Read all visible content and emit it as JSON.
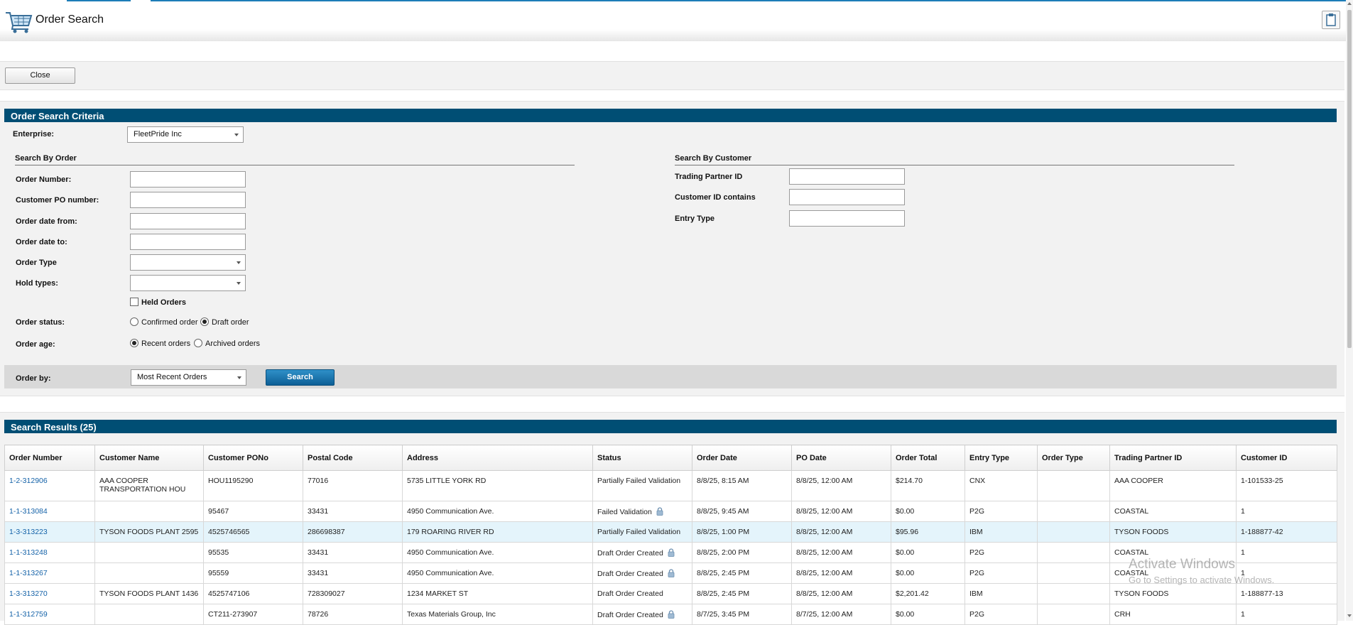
{
  "header": {
    "title": "Order Search",
    "cart_icon": "shopping-cart-icon",
    "clipboard_icon": "clipboard-icon"
  },
  "toolbar": {
    "close_label": "Close"
  },
  "criteria": {
    "title": "Order Search Criteria",
    "enterprise": {
      "label": "Enterprise:",
      "value": "FleetPride Inc"
    },
    "by_order": {
      "title": "Search By Order",
      "order_number": "Order Number:",
      "customer_po": "Customer PO number:",
      "date_from": "Order date from:",
      "date_to": "Order date to:",
      "order_type": "Order Type",
      "hold_types": "Hold types:",
      "held_orders": "Held Orders",
      "order_status": "Order status:",
      "status_confirmed": "Confirmed order",
      "status_draft": "Draft order",
      "order_age": "Order age:",
      "age_recent": "Recent orders",
      "age_archived": "Archived orders",
      "order_by": "Order by:",
      "order_by_value": "Most Recent Orders",
      "search_label": "Search"
    },
    "by_customer": {
      "title": "Search By Customer",
      "trading_partner": "Trading Partner ID",
      "customer_id": "Customer ID contains",
      "entry_type": "Entry Type"
    }
  },
  "results": {
    "title": "Search Results (25)",
    "columns": [
      "Order Number",
      "Customer Name",
      "Customer PONo",
      "Postal Code",
      "Address",
      "Status",
      "Order Date",
      "PO Date",
      "Order Total",
      "Entry Type",
      "Order Type",
      "Trading Partner ID",
      "Customer ID"
    ],
    "rows": [
      [
        "1-2-312906",
        "AAA COOPER TRANSPORTATION HOU",
        "HOU1195290",
        "77016",
        "5735 LITTLE YORK RD",
        "Partially Failed Validation",
        "8/8/25, 8:15 AM",
        "8/8/25, 12:00 AM",
        "$214.70",
        "CNX",
        "",
        "AAA COOPER",
        "1-101533-25"
      ],
      [
        "1-1-313084",
        "",
        "95467",
        "33431",
        "4950 Communication Ave.",
        "Failed Validation",
        "8/8/25, 9:45 AM",
        "8/8/25, 12:00 AM",
        "$0.00",
        "P2G",
        "",
        "COASTAL",
        "1"
      ],
      [
        "1-3-313223",
        "TYSON FOODS PLANT 2595",
        "4525746565",
        "286698387",
        "179 ROARING RIVER RD",
        "Partially Failed Validation",
        "8/8/25, 1:00 PM",
        "8/8/25, 12:00 AM",
        "$95.96",
        "IBM",
        "",
        "TYSON FOODS",
        "1-188877-42"
      ],
      [
        "1-1-313248",
        "",
        "95535",
        "33431",
        "4950 Communication Ave.",
        "Draft Order Created",
        "8/8/25, 2:00 PM",
        "8/8/25, 12:00 AM",
        "$0.00",
        "P2G",
        "",
        "COASTAL",
        "1"
      ],
      [
        "1-1-313267",
        "",
        "95559",
        "33431",
        "4950 Communication Ave.",
        "Draft Order Created",
        "8/8/25, 2:45 PM",
        "8/8/25, 12:00 AM",
        "$0.00",
        "P2G",
        "",
        "COASTAL",
        "1"
      ],
      [
        "1-3-313270",
        "TYSON FOODS PLANT 1436",
        "4525747106",
        "728309027",
        "1234 MARKET ST",
        "Draft Order Created",
        "8/8/25, 2:45 PM",
        "8/8/25, 12:00 AM",
        "$2,201.42",
        "IBM",
        "",
        "TYSON FOODS",
        "1-188877-13"
      ],
      [
        "1-1-312759",
        "",
        "CT211-273907",
        "78726",
        "Texas Materials Group, Inc",
        "Draft Order Created",
        "8/7/25, 3:45 PM",
        "8/7/25, 12:00 AM",
        "$0.00",
        "P2G",
        "",
        "CRH",
        "1"
      ]
    ],
    "locked_rows": [
      1,
      3,
      4,
      6
    ],
    "highlight_row": 2
  },
  "watermark": {
    "line1": "Activate Windows",
    "line2": "Go to Settings to activate Windows."
  },
  "colors": {
    "section_header": "#004e74",
    "link": "#1462a8",
    "search_button": "#1a74b0",
    "highlight_row": "#e4f4fb"
  }
}
